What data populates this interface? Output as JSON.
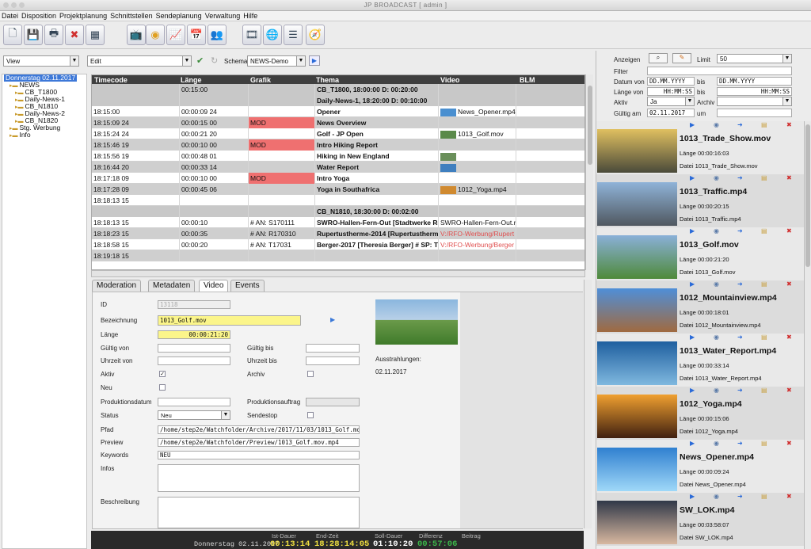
{
  "window": {
    "title": "JP BROADCAST [ admin ]"
  },
  "menu": [
    "Datei",
    "Disposition",
    "Projektplanung",
    "Schnittstellen",
    "Sendeplanung",
    "Verwaltung",
    "Hilfe"
  ],
  "toolbar": {
    "icons": [
      "new-document-icon",
      "save-icon",
      "print-icon",
      "delete-icon",
      "grid-icon",
      "tv-icon",
      "coin-icon",
      "chart-icon",
      "calendar-icon",
      "users-icon",
      "film-icon",
      "globe-user-icon",
      "list-icon",
      "compass-icon"
    ]
  },
  "subbar": {
    "view": "View",
    "edit": "Edit",
    "schema_label": "Schema",
    "schema": "NEWS-Demo"
  },
  "tree": [
    {
      "label": "Donnerstag 02.11.2017",
      "level": 0,
      "selected": true
    },
    {
      "label": "NEWS",
      "level": 1
    },
    {
      "label": "CB_T1800",
      "level": 2
    },
    {
      "label": "Daily-News-1",
      "level": 2
    },
    {
      "label": "CB_N1810",
      "level": 2
    },
    {
      "label": "Daily-News-2",
      "level": 2
    },
    {
      "label": "CB_N1820",
      "level": 2
    },
    {
      "label": "Stg. Werbung",
      "level": 1
    },
    {
      "label": "Info",
      "level": 1
    }
  ],
  "grid": {
    "headers": [
      "Timecode",
      "Länge",
      "Grafik",
      "Thema",
      "Video",
      "BLM"
    ],
    "rows": [
      {
        "tc": "",
        "len": "00:15:00",
        "gfx": "",
        "thema": "CB_T1800, 18:00:00   D: 00:20:00",
        "video": "",
        "sep": true
      },
      {
        "tc": "",
        "len": "",
        "gfx": "",
        "thema": "Daily-News-1, 18:20:00   D: 00:10:00",
        "video": "",
        "sep": true
      },
      {
        "tc": "18:15:00",
        "len": "00:00:09 24",
        "gfx": "",
        "thema": "Opener",
        "video": "News_Opener.mp4",
        "thumb": "#4a8fd0"
      },
      {
        "tc": "18:15:09 24",
        "len": "00:00:15 00",
        "gfx": "MOD",
        "thema": "News Overview",
        "video": "",
        "sep": true
      },
      {
        "tc": "18:15:24 24",
        "len": "00:00:21 20",
        "gfx": "",
        "thema": "Golf - JP Open",
        "video": "1013_Golf.mov",
        "thumb": "#5b8a4a"
      },
      {
        "tc": "18:15:46 19",
        "len": "00:00:10 00",
        "gfx": "MOD",
        "thema": "Intro Hiking Report",
        "video": "",
        "sep": true
      },
      {
        "tc": "18:15:56 19",
        "len": "00:00:48 01",
        "gfx": "",
        "thema": "Hiking in New England",
        "video": "",
        "thumb": "#6a8f5a"
      },
      {
        "tc": "18:16:44 20",
        "len": "00:00:33 14",
        "gfx": "",
        "thema": "Water Report",
        "video": "",
        "thumb": "#3f7fbf",
        "sep": true
      },
      {
        "tc": "18:17:18 09",
        "len": "00:00:10 00",
        "gfx": "MOD",
        "thema": "Intro Yoga",
        "video": ""
      },
      {
        "tc": "18:17:28 09",
        "len": "00:00:45 06",
        "gfx": "",
        "thema": "Yoga in Southafrica",
        "video": "1012_Yoga.mp4",
        "thumb": "#d08a30",
        "sep": true
      },
      {
        "tc": "18:18:13 15",
        "len": "",
        "gfx": "",
        "thema": "",
        "video": ""
      },
      {
        "tc": "",
        "len": "",
        "gfx": "",
        "thema": "CB_N1810, 18:30:00   D: 00:02:00",
        "video": "",
        "sep": true
      },
      {
        "tc": "18:18:13 15",
        "len": "00:00:10",
        "gfx": "# AN: S170111",
        "thema": "SWRO-Hallen-Fern-Out [Stadtwerke Ros",
        "video": "SWRO-Hallen-Fern-Out.r"
      },
      {
        "tc": "18:18:23 15",
        "len": "00:00:35",
        "gfx": "# AN: R170310",
        "thema": "Rupertustherme-2014 [Rupertustherme",
        "video": "V:/RFO-Werbung/Rupert",
        "red": true,
        "sep": true
      },
      {
        "tc": "18:18:58 15",
        "len": "00:00:20",
        "gfx": "# AN: T17031",
        "thema": "Berger-2017 [Theresia Berger] # SP: T10",
        "video": "V:/RFO-Werbung/Berger",
        "red": true
      },
      {
        "tc": "18:19:18 15",
        "len": "",
        "gfx": "",
        "thema": "",
        "video": "",
        "sep": true
      }
    ]
  },
  "tabs": [
    "Moderation",
    "Metadaten",
    "Video",
    "Events"
  ],
  "active_tab": "Video",
  "form": {
    "id_label": "ID",
    "id_value": "13118",
    "bez_label": "Bezeichnung",
    "bez_value": "1013_Golf.mov",
    "laenge_label": "Länge",
    "laenge_value": "00:00:21:20",
    "gueltig_von": "Gültig von",
    "gueltig_bis": "Gültig bis",
    "uhrzeit_von": "Uhrzeit von",
    "uhrzeit_bis": "Uhrzeit bis",
    "aktiv": "Aktiv",
    "archiv": "Archiv",
    "neu": "Neu",
    "produktionsdatum": "Produktionsdatum",
    "produktionsauftrag": "Produktionsauftrag",
    "status_label": "Status",
    "status_value": "Neu",
    "sendestop": "Sendestop",
    "pfad_label": "Pfad",
    "pfad_value": "/home/step2e/Watchfolder/Archive/2017/11/03/1013_Golf.mov",
    "preview_label": "Preview",
    "preview_value": "/home/step2e/Watchfolder/Preview/1013_Golf.mov.mp4",
    "keywords_label": "Keywords",
    "keywords_value": "NEU",
    "infos_label": "Infos",
    "beschreibung_label": "Beschreibung",
    "ausstrahlungen_label": "Ausstrahlungen:",
    "ausstrahlungen_value": "02.11.2017",
    "aktiv_checked": true
  },
  "status": {
    "date": "Donnerstag 02.11.2017",
    "ist_label": "Ist-Dauer",
    "ist": "00:13:14",
    "end_label": "End-Zeit",
    "end": "18:28:14:05",
    "soll_label": "Soll-Dauer",
    "soll": "01:10:20",
    "diff_label": "Differenz",
    "diff": "00:57:06",
    "beitrag_label": "Beitrag"
  },
  "filter": {
    "anzeigen": "Anzeigen",
    "limit_label": "Limit",
    "limit": "50",
    "filter_label": "Filter",
    "datum_von_label": "Datum von",
    "datum_von": "DD.MM.YYYY",
    "bis": "bis",
    "datum_bis": "DD.MM.YYYY",
    "laenge_von_label": "Länge von",
    "laenge_von": "HH:MM:SS",
    "laenge_bis": "HH:MM:SS",
    "aktiv_label": "Aktiv",
    "aktiv": "Ja",
    "archiv_label": "Archiv",
    "gueltig_label": "Gültig am",
    "gueltig": "02.11.2017",
    "um": "um"
  },
  "media": [
    {
      "name": "1013_Trade_Show.mov",
      "laenge": "00:00:16:03",
      "datei": "1013_Trade_Show.mov",
      "c1": "#e0c060",
      "c2": "#4a4a3a"
    },
    {
      "name": "1013_Traffic.mp4",
      "laenge": "00:00:20:15",
      "datei": "1013_Traffic.mp4",
      "c1": "#8fb3d8",
      "c2": "#505860"
    },
    {
      "name": "1013_Golf.mov",
      "laenge": "00:00:21:20",
      "datei": "1013_Golf.mov",
      "c1": "#8ab0d8",
      "c2": "#4f8a3a"
    },
    {
      "name": "1012_Mountainview.mp4",
      "laenge": "00:00:18:01",
      "datei": "1012_Mountainview.mp4",
      "c1": "#4f8fd8",
      "c2": "#a06a40"
    },
    {
      "name": "1013_Water_Report.mp4",
      "laenge": "00:00:33:14",
      "datei": "1013_Water_Report.mp4",
      "c1": "#1f5f9f",
      "c2": "#7fb8df"
    },
    {
      "name": "1012_Yoga.mp4",
      "laenge": "00:00:15:06",
      "datei": "1012_Yoga.mp4",
      "c1": "#f0a030",
      "c2": "#402010"
    },
    {
      "name": "News_Opener.mp4",
      "laenge": "00:00:09:24",
      "datei": "News_Opener.mp4",
      "c1": "#3080d0",
      "c2": "#9fd8f8"
    },
    {
      "name": "SW_LOK.mp4",
      "laenge": "00:03:58:07",
      "datei": "SW_LOK.mp4",
      "c1": "#303848",
      "c2": "#d8b8a0"
    }
  ],
  "media_labels": {
    "laenge": "Länge",
    "datei": "Datei"
  }
}
